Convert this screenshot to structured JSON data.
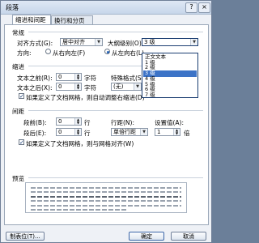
{
  "window": {
    "title": "段落",
    "help": "?",
    "close": "×"
  },
  "tabs": [
    {
      "label": "缩进和间距(I)"
    },
    {
      "label": "换行和分页(P)"
    }
  ],
  "general": {
    "section": "常规",
    "alignment_label": "对齐方式(G):",
    "alignment_value": "居中对齐",
    "outline_label": "大纲级别(O):",
    "outline_value": "3 级",
    "direction_label": "方向:",
    "direction_rtl": "从右向左(F)",
    "direction_ltr": "从左向右(L)",
    "direction_selected": "ltr"
  },
  "outline_options": [
    "正文文本",
    "1 级",
    "2 级",
    "3 级",
    "4 级",
    "5 级",
    "6 级",
    "7 级"
  ],
  "outline_selected_index": 3,
  "indent": {
    "section": "缩进",
    "before_label": "文本之前(R):",
    "before_value": "0",
    "before_unit": "字符",
    "after_label": "文本之后(X):",
    "after_value": "0",
    "after_unit": "字符",
    "special_label": "特殊格式(S):",
    "special_value": "(无)",
    "grid_check_label": "如果定义了文档网格，则自动调整右缩进(D)",
    "grid_checked": true
  },
  "spacing": {
    "section": "间距",
    "before_label": "段前(B):",
    "before_value": "0",
    "before_unit": "行",
    "after_label": "段后(E):",
    "after_value": "0",
    "after_unit": "行",
    "line_label": "行距(N):",
    "line_value": "单倍行距",
    "setting_label": "设置值(A):",
    "setting_value": "1",
    "setting_unit": "倍",
    "grid_check_label": "如果定义了文档网格，则与网格对齐(W)",
    "grid_checked": true
  },
  "preview": {
    "section": "预览"
  },
  "footer": {
    "tabs_button": "制表位(T)...",
    "ok_button": "确定",
    "cancel_button": "取消"
  }
}
